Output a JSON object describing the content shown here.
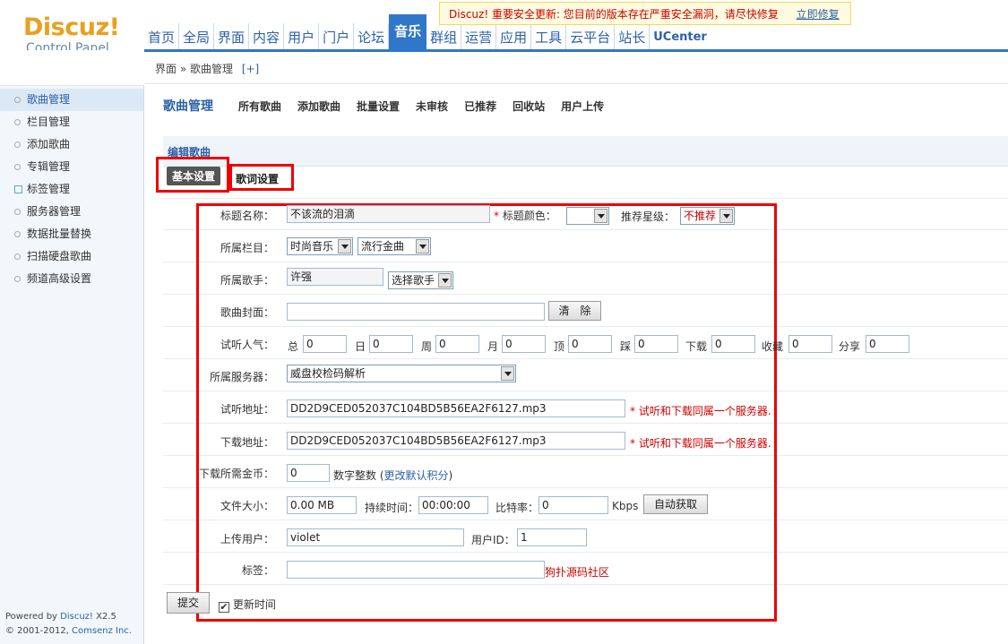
{
  "logo": {
    "brand": "Discuz!",
    "sub": "Control Panel"
  },
  "alert": {
    "text": "Discuz! 重要安全更新: 您目前的版本存在严重安全漏洞，请尽快修复",
    "link": "立即修复"
  },
  "nav": [
    "首页",
    "全局",
    "界面",
    "内容",
    "用户",
    "门户",
    "论坛",
    "音乐",
    "群组",
    "运营",
    "应用",
    "工具",
    "云平台",
    "站长",
    "UCenter"
  ],
  "nav_active": "音乐",
  "breadcrumb": {
    "path": "界面 » 歌曲管理",
    "plus": "[+]"
  },
  "sidebar": {
    "items": [
      "歌曲管理",
      "栏目管理",
      "添加歌曲",
      "专辑管理",
      "标签管理",
      "服务器管理",
      "数据批量替换",
      "扫描硬盘歌曲",
      "频道高级设置"
    ],
    "powered_prefix": "Powered by ",
    "powered_link": "Discuz!",
    "powered_version": " X2.5",
    "copyright_prefix": "© 2001-2012, ",
    "copyright_link": "Comsenz Inc."
  },
  "subnav": {
    "title": "歌曲管理",
    "links": [
      "所有歌曲",
      "添加歌曲",
      "批量设置",
      "未审核",
      "已推荐",
      "回收站",
      "用户上传"
    ]
  },
  "section": {
    "title": "编辑歌曲"
  },
  "tabs": {
    "basic": "基本设置",
    "lyrics": "歌词设置"
  },
  "form": {
    "title_label": "标题名称：",
    "title_value": "不该流的泪滴",
    "title_color_label": "标题颜色：",
    "star_label": "推荐星级：",
    "star_value": "不推荐",
    "category_label": "所属栏目：",
    "category_value1": "时尚音乐",
    "category_value2": "流行金曲",
    "singer_label": "所属歌手：",
    "singer_value": "许强",
    "singer_select": "选择歌手",
    "cover_label": "歌曲封面：",
    "cover_value": "",
    "clear_button": "清　除",
    "pop_label": "试听人气：",
    "pop_fields": [
      {
        "label": "总",
        "value": "0"
      },
      {
        "label": "日",
        "value": "0"
      },
      {
        "label": "周",
        "value": "0"
      },
      {
        "label": "月",
        "value": "0"
      },
      {
        "label": "顶",
        "value": "0"
      },
      {
        "label": "踩",
        "value": "0"
      },
      {
        "label": "下载",
        "value": "0"
      },
      {
        "label": "收藏",
        "value": "0"
      },
      {
        "label": "分享",
        "value": "0"
      }
    ],
    "server_label": "所属服务器：",
    "server_value": "威盘校检码解析",
    "listen_label": "试听地址：",
    "listen_value": "DD2D9CED052037C104BD5B56EA2F6127.mp3",
    "same_server_hint": "试听和下载同属一个服务器.",
    "download_label": "下载地址：",
    "download_value": "DD2D9CED052037C104BD5B56EA2F6127.mp3",
    "coin_label": "下载所需金币：",
    "coin_value": "0",
    "coin_hint": "数字整数",
    "coin_link": "更改默认积分",
    "size_label": "文件大小：",
    "size_value": "0.00 MB",
    "duration_label": "持续时间：",
    "duration_value": "00:00:00",
    "bitrate_label": "比特率：",
    "bitrate_value": "0",
    "bitrate_unit": "Kbps",
    "auto_button": "自动获取",
    "uploader_label": "上传用户：",
    "uploader_value": "violet",
    "uid_label": "用户ID：",
    "uid_value": "1",
    "tag_label": "标签：",
    "tag_value": "",
    "tag_hint": "狗扑源码社区",
    "submit_button": "提交",
    "update_time_label": "更新时间"
  }
}
